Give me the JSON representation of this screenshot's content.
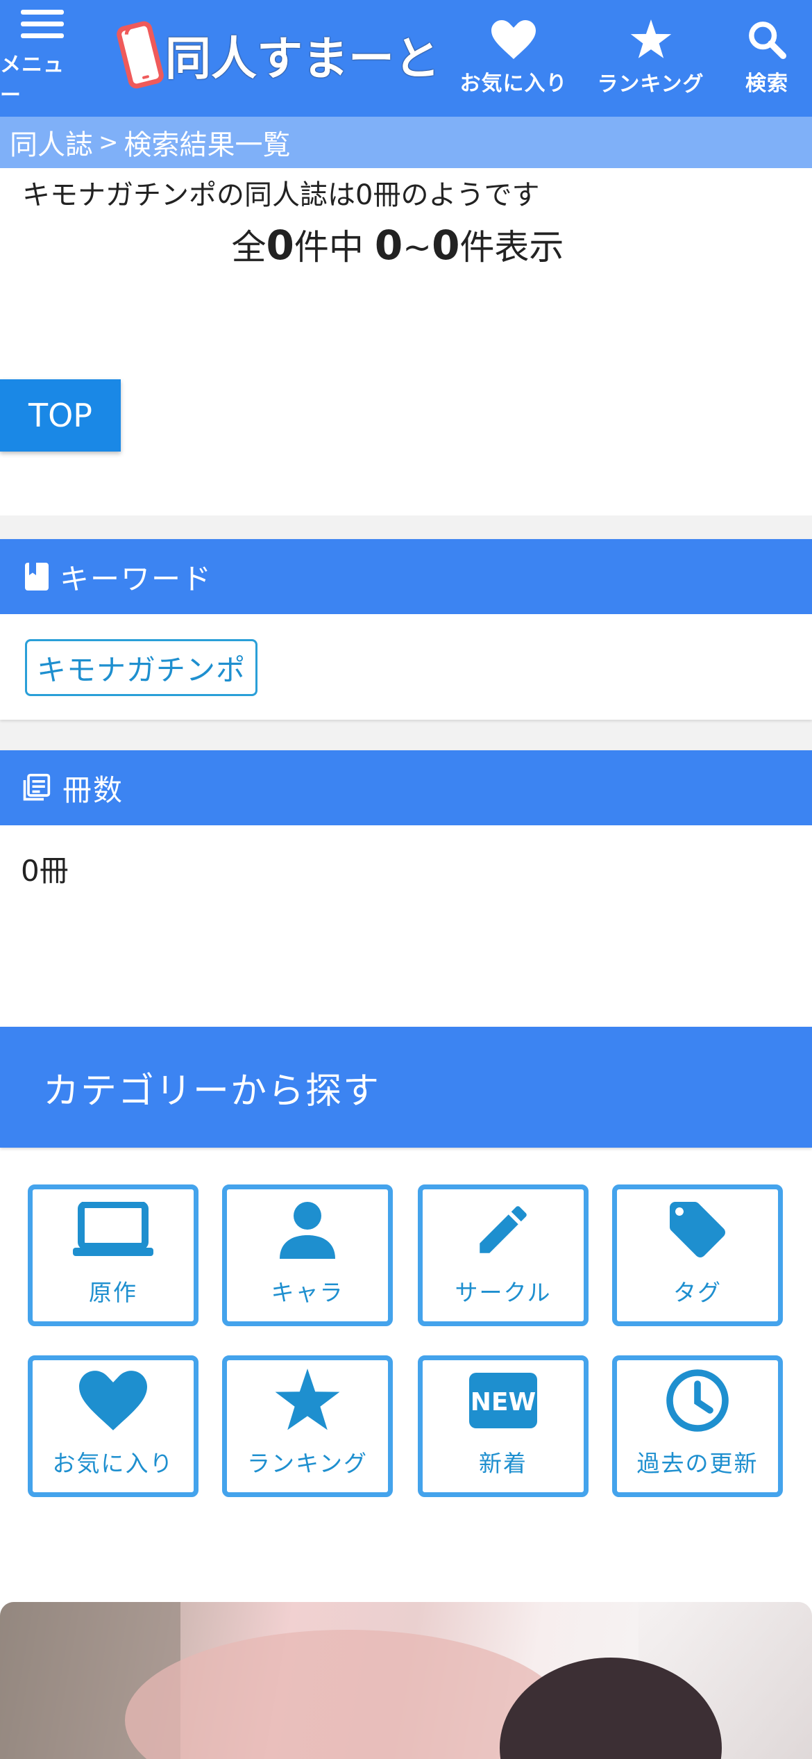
{
  "header": {
    "menu_label": "メニュー",
    "logo_text": "同人すまーと",
    "favorites_label": "お気に入り",
    "ranking_label": "ランキング",
    "search_label": "検索",
    "bg_color": "#3c84f2"
  },
  "breadcrumb": {
    "root": "同人誌",
    "sep": ">",
    "current": "検索結果一覧"
  },
  "results": {
    "message": "キモナガチンポの同人誌は0冊のようです",
    "count_prefix": "全",
    "total": "0",
    "count_mid": "件中",
    "range_start": "0",
    "range_sep": "~",
    "range_end": "0",
    "count_suffix": "件表示",
    "top_button": "TOP"
  },
  "keyword_section": {
    "title": "キーワード",
    "tag": "キモナガチンポ"
  },
  "count_section": {
    "title": "冊数",
    "value": "0冊"
  },
  "categories": {
    "title": "カテゴリーから探す",
    "items": [
      {
        "label": "原作",
        "icon": "laptop-icon"
      },
      {
        "label": "キャラ",
        "icon": "person-icon"
      },
      {
        "label": "サークル",
        "icon": "pencil-icon"
      },
      {
        "label": "タグ",
        "icon": "tag-icon"
      },
      {
        "label": "お気に入り",
        "icon": "heart-icon"
      },
      {
        "label": "ランキング",
        "icon": "star-icon"
      },
      {
        "label": "新着",
        "icon": "new-badge-icon"
      },
      {
        "label": "過去の更新",
        "icon": "clock-icon"
      }
    ],
    "accent_color": "#44a3ec"
  }
}
